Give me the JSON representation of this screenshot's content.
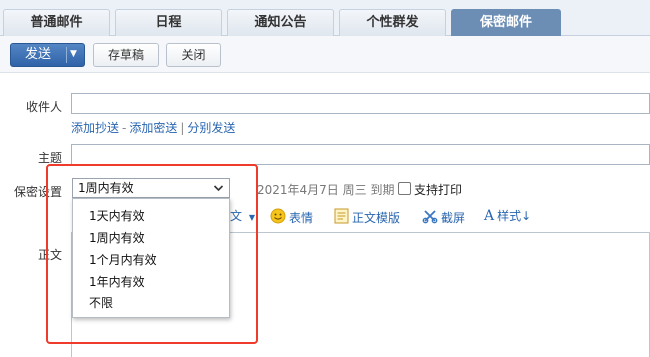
{
  "tabs": [
    {
      "label": "普通邮件"
    },
    {
      "label": "日程"
    },
    {
      "label": "通知公告"
    },
    {
      "label": "个性群发"
    },
    {
      "label": "保密邮件",
      "active": true
    }
  ],
  "toolbar": {
    "send_label": "发送",
    "draft_label": "存草稿",
    "close_label": "关闭"
  },
  "form": {
    "recipient_label": "收件人",
    "recipient_value": "",
    "link_cc": "添加抄送",
    "link_bcc": "添加密送",
    "link_separate": "分别发送",
    "link_sep1": "-",
    "link_sep2": "|",
    "subject_label": "主题",
    "subject_value": "",
    "security_label": "保密设置",
    "security_value": "1周内有效",
    "expire_text": "2021年4月7日 周三 到期",
    "print_label": "支持打印",
    "print_checked": false,
    "body_label": "正文"
  },
  "editor_toolbar": {
    "partial_item": "文",
    "emoji": "表情",
    "template": "正文模版",
    "screenshot": "截屏",
    "style": "样式"
  },
  "dropdown": {
    "options": [
      "1天内有效",
      "1周内有效",
      "1个月内有效",
      "1年内有效",
      "不限"
    ]
  },
  "colors": {
    "active_tab": "#6c8db4",
    "send_button": "#2f62a8",
    "link": "#2a66b0",
    "highlight_box": "#ee3b2b"
  }
}
